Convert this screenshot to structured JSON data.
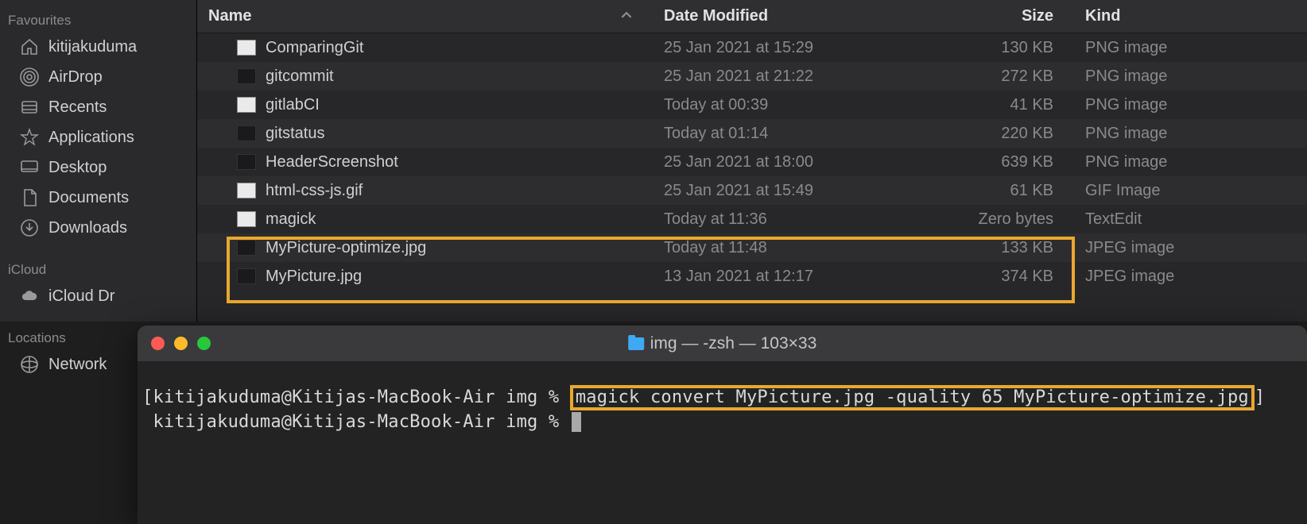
{
  "sidebar": {
    "sections": [
      {
        "title": "Favourites",
        "items": [
          {
            "icon": "home-icon",
            "label": "kitijakuduma"
          },
          {
            "icon": "airdrop-icon",
            "label": "AirDrop"
          },
          {
            "icon": "recents-icon",
            "label": "Recents"
          },
          {
            "icon": "applications-icon",
            "label": "Applications"
          },
          {
            "icon": "desktop-icon",
            "label": "Desktop"
          },
          {
            "icon": "documents-icon",
            "label": "Documents"
          },
          {
            "icon": "downloads-icon",
            "label": "Downloads"
          }
        ]
      },
      {
        "title": "iCloud",
        "items": [
          {
            "icon": "cloud-icon",
            "label": "iCloud Dr"
          }
        ]
      },
      {
        "title": "Locations",
        "items": [
          {
            "icon": "network-icon",
            "label": "Network"
          }
        ]
      }
    ]
  },
  "columns": {
    "name": "Name",
    "date": "Date Modified",
    "size": "Size",
    "kind": "Kind"
  },
  "files": [
    {
      "name": "ComparingGit",
      "date": "25 Jan 2021 at 15:29",
      "size": "130 KB",
      "kind": "PNG image",
      "thumb": "w"
    },
    {
      "name": "gitcommit",
      "date": "25 Jan 2021 at 21:22",
      "size": "272 KB",
      "kind": "PNG image",
      "thumb": "d"
    },
    {
      "name": "gitlabCI",
      "date": "Today at 00:39",
      "size": "41 KB",
      "kind": "PNG image",
      "thumb": "w"
    },
    {
      "name": "gitstatus",
      "date": "Today at 01:14",
      "size": "220 KB",
      "kind": "PNG image",
      "thumb": "d"
    },
    {
      "name": "HeaderScreenshot",
      "date": "25 Jan 2021 at 18:00",
      "size": "639 KB",
      "kind": "PNG image",
      "thumb": "d"
    },
    {
      "name": "html-css-js.gif",
      "date": "25 Jan 2021 at 15:49",
      "size": "61 KB",
      "kind": "GIF Image",
      "thumb": "w"
    },
    {
      "name": "magick",
      "date": "Today at 11:36",
      "size": "Zero bytes",
      "kind": "TextEdit",
      "thumb": "w"
    },
    {
      "name": "MyPicture-optimize.jpg",
      "date": "Today at 11:48",
      "size": "133 KB",
      "kind": "JPEG image",
      "thumb": "d"
    },
    {
      "name": "MyPicture.jpg",
      "date": "13 Jan 2021 at 12:17",
      "size": "374 KB",
      "kind": "JPEG image",
      "thumb": "d"
    }
  ],
  "terminal": {
    "title": "img — -zsh — 103×33",
    "prompt_bracket_open": "[",
    "prompt_bracket_close": "]",
    "prompt1_user": "kitijakuduma@Kitijas-MacBook-Air img %",
    "command": "magick convert MyPicture.jpg -quality 65 MyPicture-optimize.jpg",
    "prompt2_user": "kitijakuduma@Kitijas-MacBook-Air img %"
  }
}
